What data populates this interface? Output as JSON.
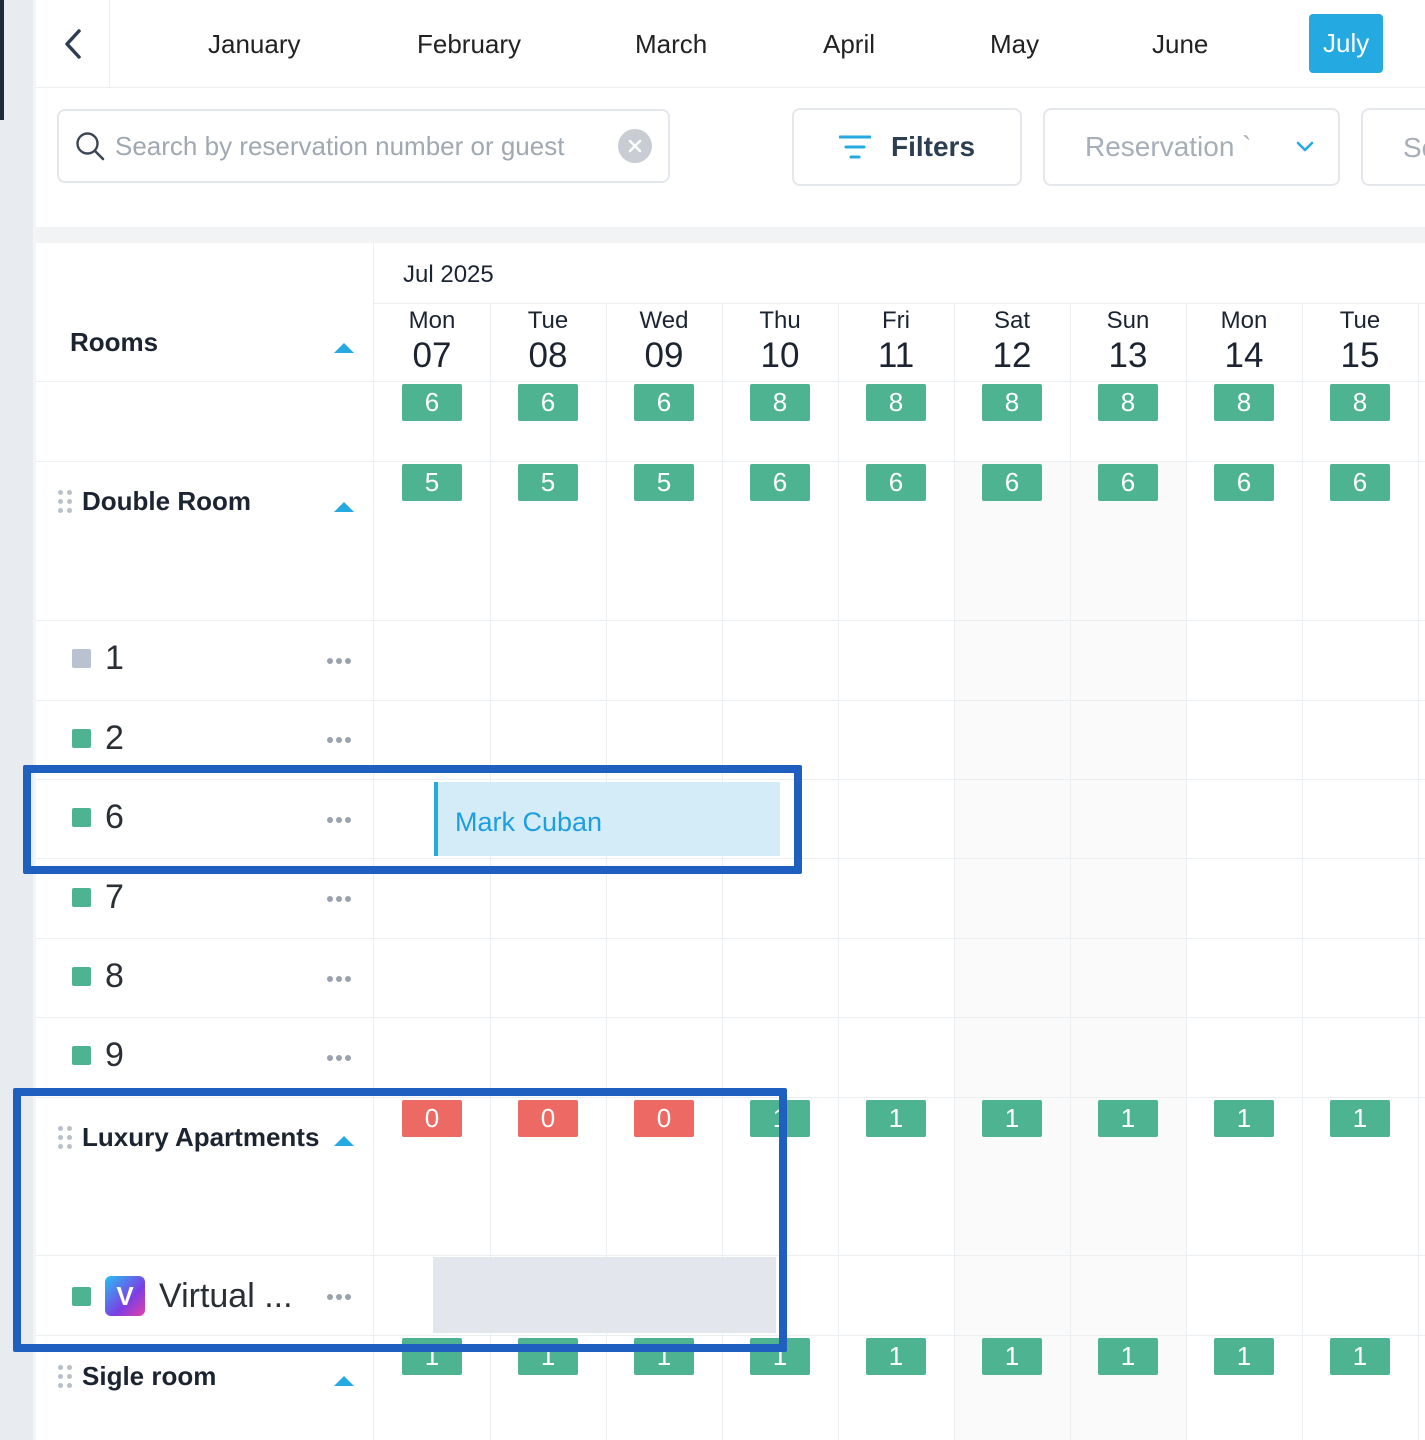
{
  "months": [
    "January",
    "February",
    "March",
    "April",
    "May",
    "June",
    "July"
  ],
  "active_month": "July",
  "search": {
    "placeholder": "Search by reservation number or guest"
  },
  "filters_label": "Filters",
  "reservation_select_label": "Reservation `",
  "cut_button_label": "Sc",
  "rooms_header": "Rooms",
  "month_year": "Jul 2025",
  "days": [
    {
      "dow": "Mon",
      "num": "07"
    },
    {
      "dow": "Tue",
      "num": "08"
    },
    {
      "dow": "Wed",
      "num": "09"
    },
    {
      "dow": "Thu",
      "num": "10"
    },
    {
      "dow": "Fri",
      "num": "11"
    },
    {
      "dow": "Sat",
      "num": "12"
    },
    {
      "dow": "Sun",
      "num": "13"
    },
    {
      "dow": "Mon",
      "num": "14"
    },
    {
      "dow": "Tue",
      "num": "15"
    }
  ],
  "total_availability": [
    "6",
    "6",
    "6",
    "8",
    "8",
    "8",
    "8",
    "8",
    "8"
  ],
  "groups": [
    {
      "name": "Double Room",
      "availability": [
        "5",
        "5",
        "5",
        "6",
        "6",
        "6",
        "6",
        "6",
        "6"
      ],
      "rooms": [
        "1",
        "2",
        "6",
        "7",
        "8",
        "9"
      ]
    },
    {
      "name": "Luxury Apartments",
      "availability": [
        "0",
        "0",
        "0",
        "1",
        "1",
        "1",
        "1",
        "1",
        "1"
      ],
      "rooms": [
        "Virtual ..."
      ]
    },
    {
      "name": "Sigle room",
      "availability": [
        "1",
        "1",
        "1",
        "1",
        "1",
        "1",
        "1",
        "1",
        "1"
      ],
      "rooms": []
    }
  ],
  "booking": {
    "guest": "Mark Cuban"
  },
  "virtual_room_logo_letter": "V",
  "colors": {
    "accent": "#24a9e1",
    "available": "#4db391",
    "unavailable": "#ec6a63",
    "booking_bg": "#d3ecf8",
    "highlight": "#1f5fbf"
  }
}
